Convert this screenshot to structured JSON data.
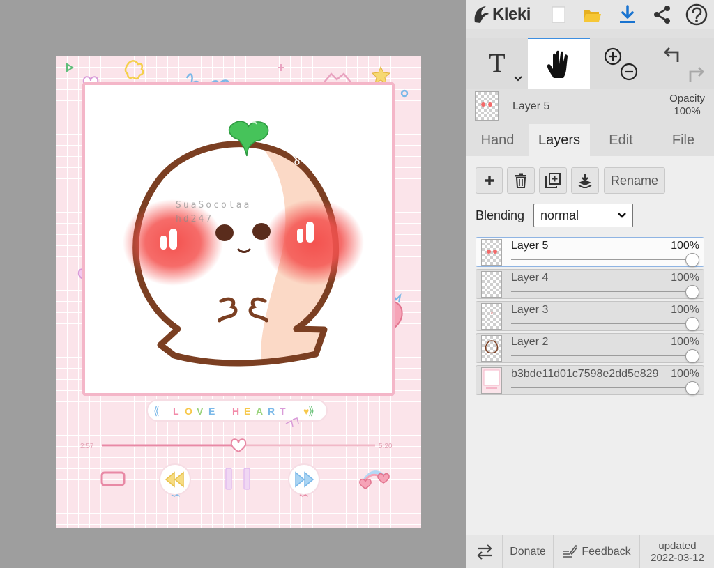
{
  "app": {
    "name": "Kleki"
  },
  "artwork": {
    "watermark_line1": "SuaSocolaa",
    "watermark_line2": "hd247",
    "heading_doodle": "Leee",
    "banner": {
      "left": "⟪",
      "letters": [
        "L",
        "O",
        "V",
        "E",
        " ",
        "H",
        "E",
        "A",
        "R",
        "T",
        " ",
        "♥"
      ],
      "right": "⟫"
    },
    "player": {
      "time_elapsed": "2:57",
      "time_total": "5:20",
      "progress": 0.5
    },
    "colors": {
      "background_pink": "#fbe4ea",
      "frame_pink": "#f4b6c8",
      "outline_brown": "#7b3f22",
      "blush_red": "#f4524f",
      "leaf_green": "#46c35a",
      "shade_peach": "#fbd9c6"
    }
  },
  "toolbar": {
    "icons": [
      "kleki-logo-icon",
      "new-file-icon",
      "open-folder-icon",
      "download-icon",
      "share-icon",
      "help-icon"
    ],
    "tools": {
      "text_tool": "T",
      "active_tool": "hand"
    }
  },
  "layer_info": {
    "name": "Layer 5",
    "opacity_label": "Opacity",
    "opacity_value": "100%"
  },
  "tabs": [
    {
      "label": "Hand",
      "active": false
    },
    {
      "label": "Layers",
      "active": true
    },
    {
      "label": "Edit",
      "active": false
    },
    {
      "label": "File",
      "active": false
    }
  ],
  "layers_panel": {
    "rename_label": "Rename",
    "blending_label": "Blending",
    "blending_value": "normal",
    "layers": [
      {
        "name": "Layer 5",
        "opacity": "100%",
        "opacity_value": 1.0,
        "selected": true
      },
      {
        "name": "Layer 4",
        "opacity": "100%",
        "opacity_value": 1.0,
        "selected": false
      },
      {
        "name": "Layer 3",
        "opacity": "100%",
        "opacity_value": 1.0,
        "selected": false
      },
      {
        "name": "Layer 2",
        "opacity": "100%",
        "opacity_value": 1.0,
        "selected": false
      },
      {
        "name": "b3bde11d01c7598e2dd5e829",
        "opacity": "100%",
        "opacity_value": 1.0,
        "selected": false
      }
    ]
  },
  "bottom_bar": {
    "donate_label": "Donate",
    "feedback_label": "Feedback",
    "updated_label": "updated",
    "updated_date": "2022-03-12"
  }
}
